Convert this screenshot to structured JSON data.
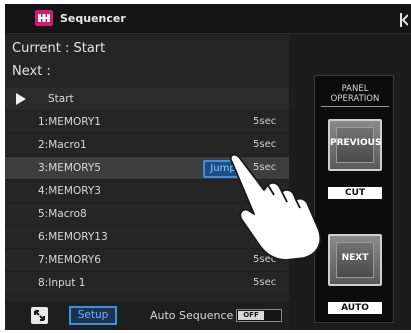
{
  "app": {
    "title": "Sequencer"
  },
  "status": {
    "current": "Current : Start",
    "next": "Next    :"
  },
  "list": {
    "header": "Start",
    "items": [
      {
        "label": "1:MEMORY1",
        "duration": "5sec"
      },
      {
        "label": "2:Macro1",
        "duration": "5sec"
      },
      {
        "label": "3:MEMORY5",
        "duration": "5sec"
      },
      {
        "label": "4:MEMORY3",
        "duration": ""
      },
      {
        "label": "5:Macro8",
        "duration": ""
      },
      {
        "label": "6:MEMORY13",
        "duration": "5sec"
      },
      {
        "label": "7:MEMORY6",
        "duration": "5sec"
      },
      {
        "label": "8:Input 1",
        "duration": "5sec"
      }
    ],
    "selected_index": 2,
    "jump_label": "Jump"
  },
  "bottom": {
    "setup_label": "Setup",
    "auto_label": "Auto Sequence",
    "toggle_state": "OFF"
  },
  "panel": {
    "title_line1": "PANEL",
    "title_line2": "OPERATION",
    "previous_label": "PREVIOUS",
    "cut_label": "CUT",
    "next_label": "NEXT",
    "auto_label": "AUTO"
  },
  "colors": {
    "accent": "#3e8ee0",
    "brand": "#d6196e"
  }
}
